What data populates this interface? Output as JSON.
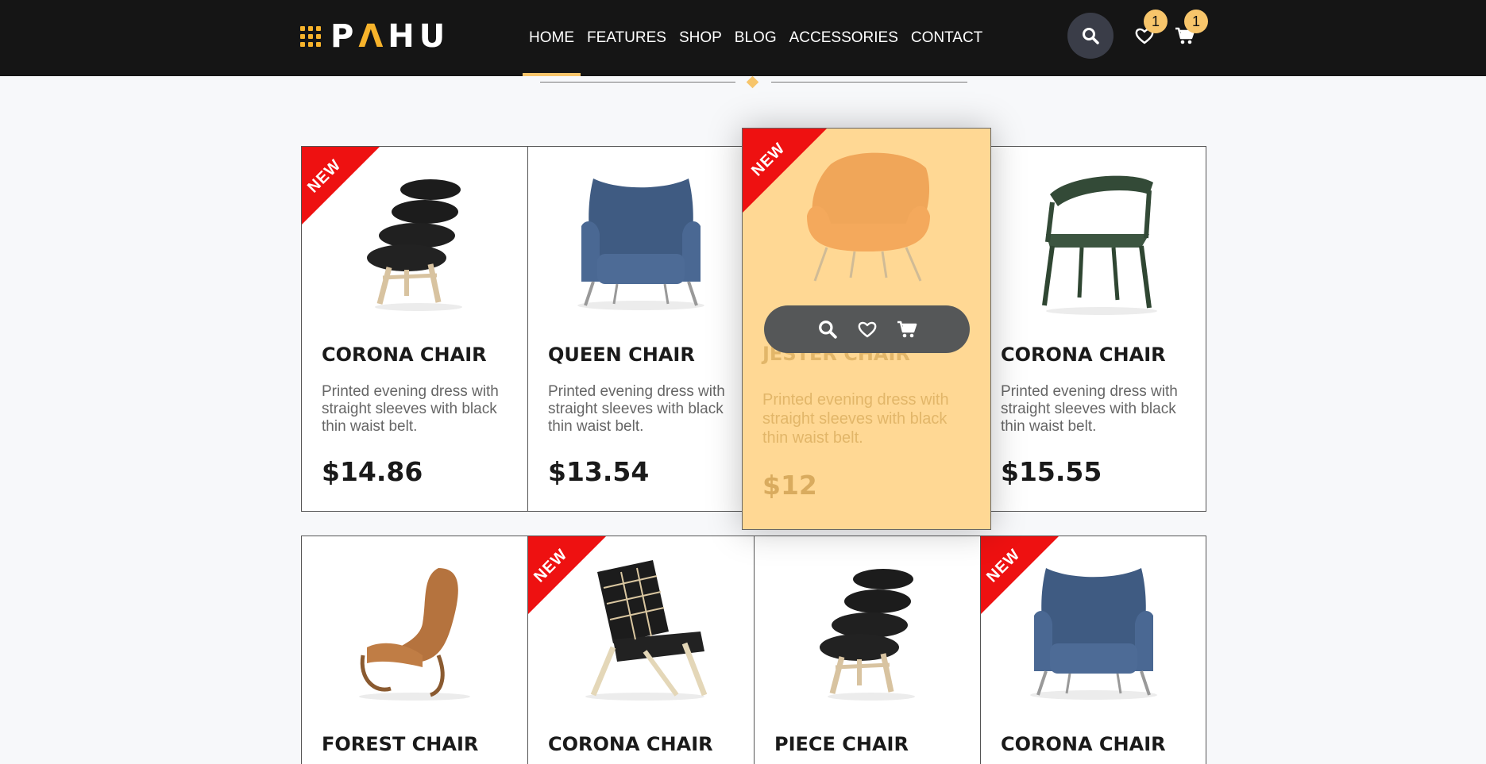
{
  "brand": {
    "logo_prefix": "P",
    "logo_accent": "Λ",
    "logo_suffix": "HU"
  },
  "nav": {
    "items": [
      "HOME",
      "FEATURES",
      "SHOP",
      "BLOG",
      "ACCESSORIES",
      "CONTACT"
    ],
    "active": "HOME"
  },
  "header": {
    "wishlist_count": "1",
    "cart_count": "1"
  },
  "colors": {
    "accent": "#f7c56b",
    "header_bg": "#151515",
    "ribbon": "#ee1111",
    "hover_card": "#ffd894"
  },
  "ribbon_label": "NEW",
  "products": [
    {
      "name": "CORONA CHAIR",
      "desc": "Printed evening dress with straight sleeves with black thin waist belt.",
      "price": "$14.86",
      "is_new": true,
      "image": "black-corona-chair"
    },
    {
      "name": "QUEEN CHAIR",
      "desc": "Printed evening dress with straight sleeves with black thin waist belt.",
      "price": "$13.54",
      "is_new": false,
      "image": "blue-wing-chair"
    },
    {
      "name": "JESTER CHAIR",
      "desc": "Printed evening dress with straight sleeves with black thin waist belt.",
      "price": "$12",
      "is_new": true,
      "image": "orange-womb-chair"
    },
    {
      "name": "CORONA CHAIR",
      "desc": "Printed evening dress with straight sleeves with black thin waist belt.",
      "price": "$15.55",
      "is_new": false,
      "image": "green-wood-chair"
    },
    {
      "name": "FOREST CHAIR",
      "is_new": false,
      "image": "brown-leather-lounge-chair"
    },
    {
      "name": "CORONA CHAIR",
      "is_new": true,
      "image": "woven-folding-chair"
    },
    {
      "name": "PIECE CHAIR",
      "is_new": false,
      "image": "black-corona-chair"
    },
    {
      "name": "CORONA CHAIR",
      "is_new": true,
      "image": "blue-wing-chair"
    }
  ]
}
